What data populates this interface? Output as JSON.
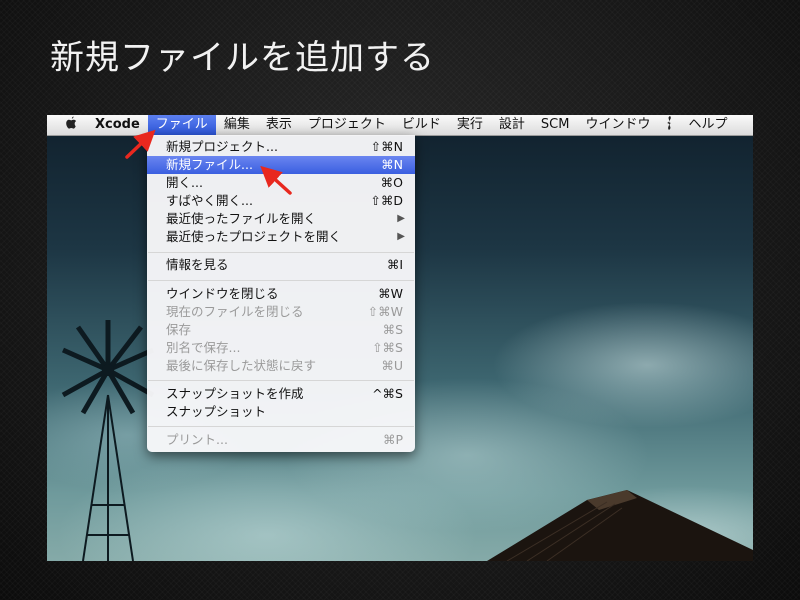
{
  "slide": {
    "title": "新規ファイルを追加する"
  },
  "menubar": {
    "apple_icon": "apple-icon",
    "app_name": "Xcode",
    "items": [
      "ファイル",
      "編集",
      "表示",
      "プロジェクト",
      "ビルド",
      "実行",
      "設計",
      "SCM",
      "ウインドウ",
      "ヘルプ"
    ],
    "script_icon": "script-menu-icon",
    "active_item": "ファイル"
  },
  "file_menu": {
    "items": [
      {
        "label": "新規プロジェクト...",
        "shortcut": "⇧⌘N",
        "enabled": true
      },
      {
        "label": "新規ファイル...",
        "shortcut": "⌘N",
        "enabled": true,
        "highlighted": true
      },
      {
        "label": "開く...",
        "shortcut": "⌘O",
        "enabled": true
      },
      {
        "label": "すばやく開く...",
        "shortcut": "⇧⌘D",
        "enabled": true
      },
      {
        "label": "最近使ったファイルを開く",
        "submenu": true,
        "enabled": true
      },
      {
        "label": "最近使ったプロジェクトを開く",
        "submenu": true,
        "enabled": true
      },
      {
        "label": "情報を見る",
        "shortcut": "⌘I",
        "enabled": true
      },
      {
        "label": "ウインドウを閉じる",
        "shortcut": "⌘W",
        "enabled": true
      },
      {
        "label": "現在のファイルを閉じる",
        "shortcut": "⇧⌘W",
        "enabled": false
      },
      {
        "label": "保存",
        "shortcut": "⌘S",
        "enabled": false
      },
      {
        "label": "別名で保存...",
        "shortcut": "⇧⌘S",
        "enabled": false
      },
      {
        "label": "最後に保存した状態に戻す",
        "shortcut": "⌘U",
        "enabled": false
      },
      {
        "label": "スナップショットを作成",
        "shortcut": "^⌘S",
        "enabled": true
      },
      {
        "label": "スナップショット",
        "enabled": true
      },
      {
        "label": "プリント...",
        "shortcut": "⌘P",
        "enabled": false
      }
    ],
    "submenu_indicator": "▶"
  },
  "annotation": {
    "arrow_color": "#e8281f",
    "highlight_color": "#3a5fe0"
  }
}
